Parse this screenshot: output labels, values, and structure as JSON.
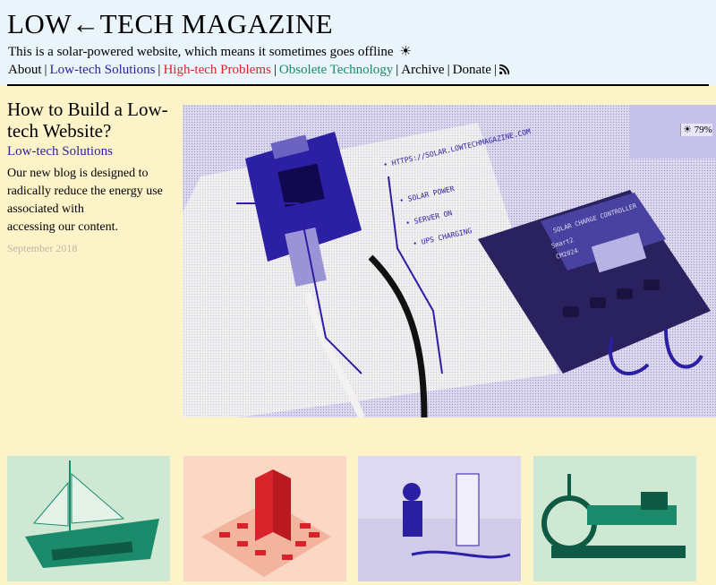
{
  "site": {
    "title": "LOW←TECH MAGAZINE",
    "tagline": "This is a solar-powered website, which means it sometimes goes offline",
    "tagline_icon": "sun-icon"
  },
  "nav": {
    "items": [
      {
        "label": "About",
        "color": "#000000"
      },
      {
        "label": "Low-tech Solutions",
        "color": "#2b1fa4"
      },
      {
        "label": "High-tech Problems",
        "color": "#d8232a"
      },
      {
        "label": "Obsolete Technology",
        "color": "#1a8a6b"
      },
      {
        "label": "Archive",
        "color": "#000000"
      },
      {
        "label": "Donate",
        "color": "#000000"
      }
    ],
    "separator": "|",
    "rss_icon": "rss-icon"
  },
  "featured": {
    "title": "How to Build a Low-tech Website?",
    "category": "Low-tech Solutions",
    "summary_lines": [
      "Our new blog is designed to",
      "radically reduce the energy use",
      "associated with",
      "accessing our content."
    ],
    "date": "September 2018",
    "image_icon": "solar-server-photo",
    "image_texts": {
      "url_label": "• HTTPS://SOLAR.LOWTECHMAGAZINE.COM",
      "label_solar": "• SOLAR POWER",
      "label_server": "• SERVER ON",
      "label_ups": "• UPS CHARGING",
      "controller_label": "SOLAR CHARGE CONTROLLER",
      "controller_brand": "Smart2",
      "controller_model": "CM2024"
    }
  },
  "battery": {
    "icon": "sun-icon",
    "level": "79%"
  },
  "thumbnails": [
    {
      "name": "sailing-ship-thumbnail",
      "color": "#1a8a6b"
    },
    {
      "name": "isometric-city-thumbnail",
      "color": "#d8232a"
    },
    {
      "name": "workers-photo-thumbnail",
      "color": "#2b1fa4"
    },
    {
      "name": "steam-engine-thumbnail",
      "color": "#1a8a6b"
    }
  ],
  "colors": {
    "header_bg": "#eaf4fb",
    "page_bg": "#fdf3c9",
    "accent_blue": "#2b1fa4",
    "accent_red": "#d8232a",
    "accent_green": "#1a8a6b"
  }
}
